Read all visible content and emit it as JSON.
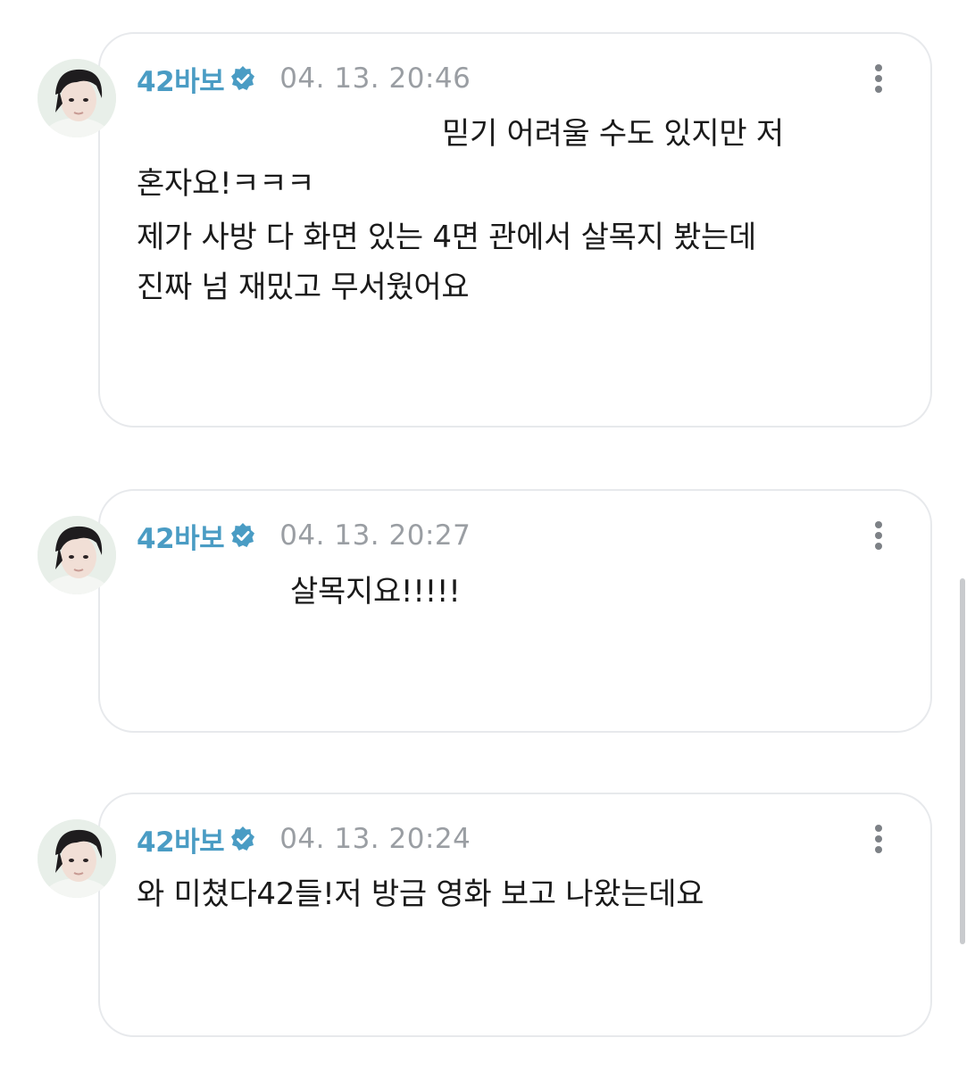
{
  "accent_color": "#4a9cc4",
  "posts": [
    {
      "author": "42바보",
      "timestamp": "04. 13. 20:46",
      "verified_icon": "verified-badge-icon",
      "menu_icon": "more-vertical-icon",
      "lines": [
        "믿기 어려울 수도 있지만 저",
        "혼자요!ㅋㅋㅋ",
        "제가 사방 다 화면 있는 4면 관에서 살목지 봤는데",
        "진짜 넘 재밌고 무서웠어요"
      ]
    },
    {
      "author": "42바보",
      "timestamp": "04. 13. 20:27",
      "verified_icon": "verified-badge-icon",
      "menu_icon": "more-vertical-icon",
      "lines": [
        "살목지요!!!!!"
      ]
    },
    {
      "author": "42바보",
      "timestamp": "04. 13. 20:24",
      "verified_icon": "verified-badge-icon",
      "menu_icon": "more-vertical-icon",
      "lines": [
        "와 미쳤다42들!저 방금 영화 보고 나왔는데요"
      ]
    }
  ]
}
